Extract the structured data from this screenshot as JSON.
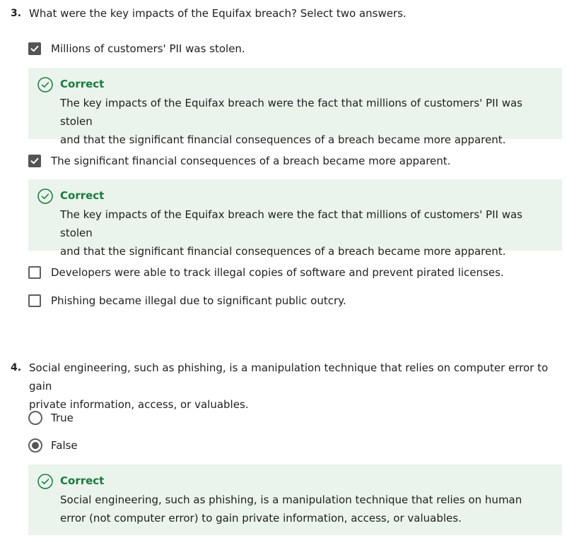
{
  "colors": {
    "correct_green": "#1a7a3d",
    "feedback_bg": "#eaf4ec",
    "control_dark": "#545454"
  },
  "questions": [
    {
      "number": "3.",
      "text": "What were the key impacts of the Equifax breach? Select two answers.",
      "options": [
        {
          "label": "Millions of customers' PII was stolen.",
          "checked": true
        },
        {
          "label": "The significant financial consequences of a breach became more apparent.",
          "checked": true
        },
        {
          "label": "Developers were able to track illegal copies of software and prevent pirated licenses.",
          "checked": false
        },
        {
          "label": "Phishing became illegal due to significant public outcry.",
          "checked": false
        }
      ],
      "feedback": [
        {
          "status": "Correct",
          "icon": "check-circle-icon",
          "line1": "The key impacts of the Equifax breach were the fact that millions of customers' PII was stolen",
          "line2": "and that the significant financial consequences of a breach became more apparent."
        },
        {
          "status": "Correct",
          "icon": "check-circle-icon",
          "line1": "The key impacts of the Equifax breach were the fact that millions of customers' PII was stolen",
          "line2": "and that the significant financial consequences of a breach became more apparent."
        }
      ]
    },
    {
      "number": "4.",
      "text_line1": "Social engineering, such as phishing, is a manipulation technique that relies on computer error to gain",
      "text_line2": "private information, access, or valuables.",
      "options": [
        {
          "label": "True",
          "selected": false
        },
        {
          "label": "False",
          "selected": true
        }
      ],
      "feedback": [
        {
          "status": "Correct",
          "icon": "check-circle-icon",
          "line1": "Social engineering, such as phishing, is a manipulation technique that relies on human",
          "line2": "error (not computer error) to gain private information, access, or valuables."
        }
      ]
    }
  ]
}
